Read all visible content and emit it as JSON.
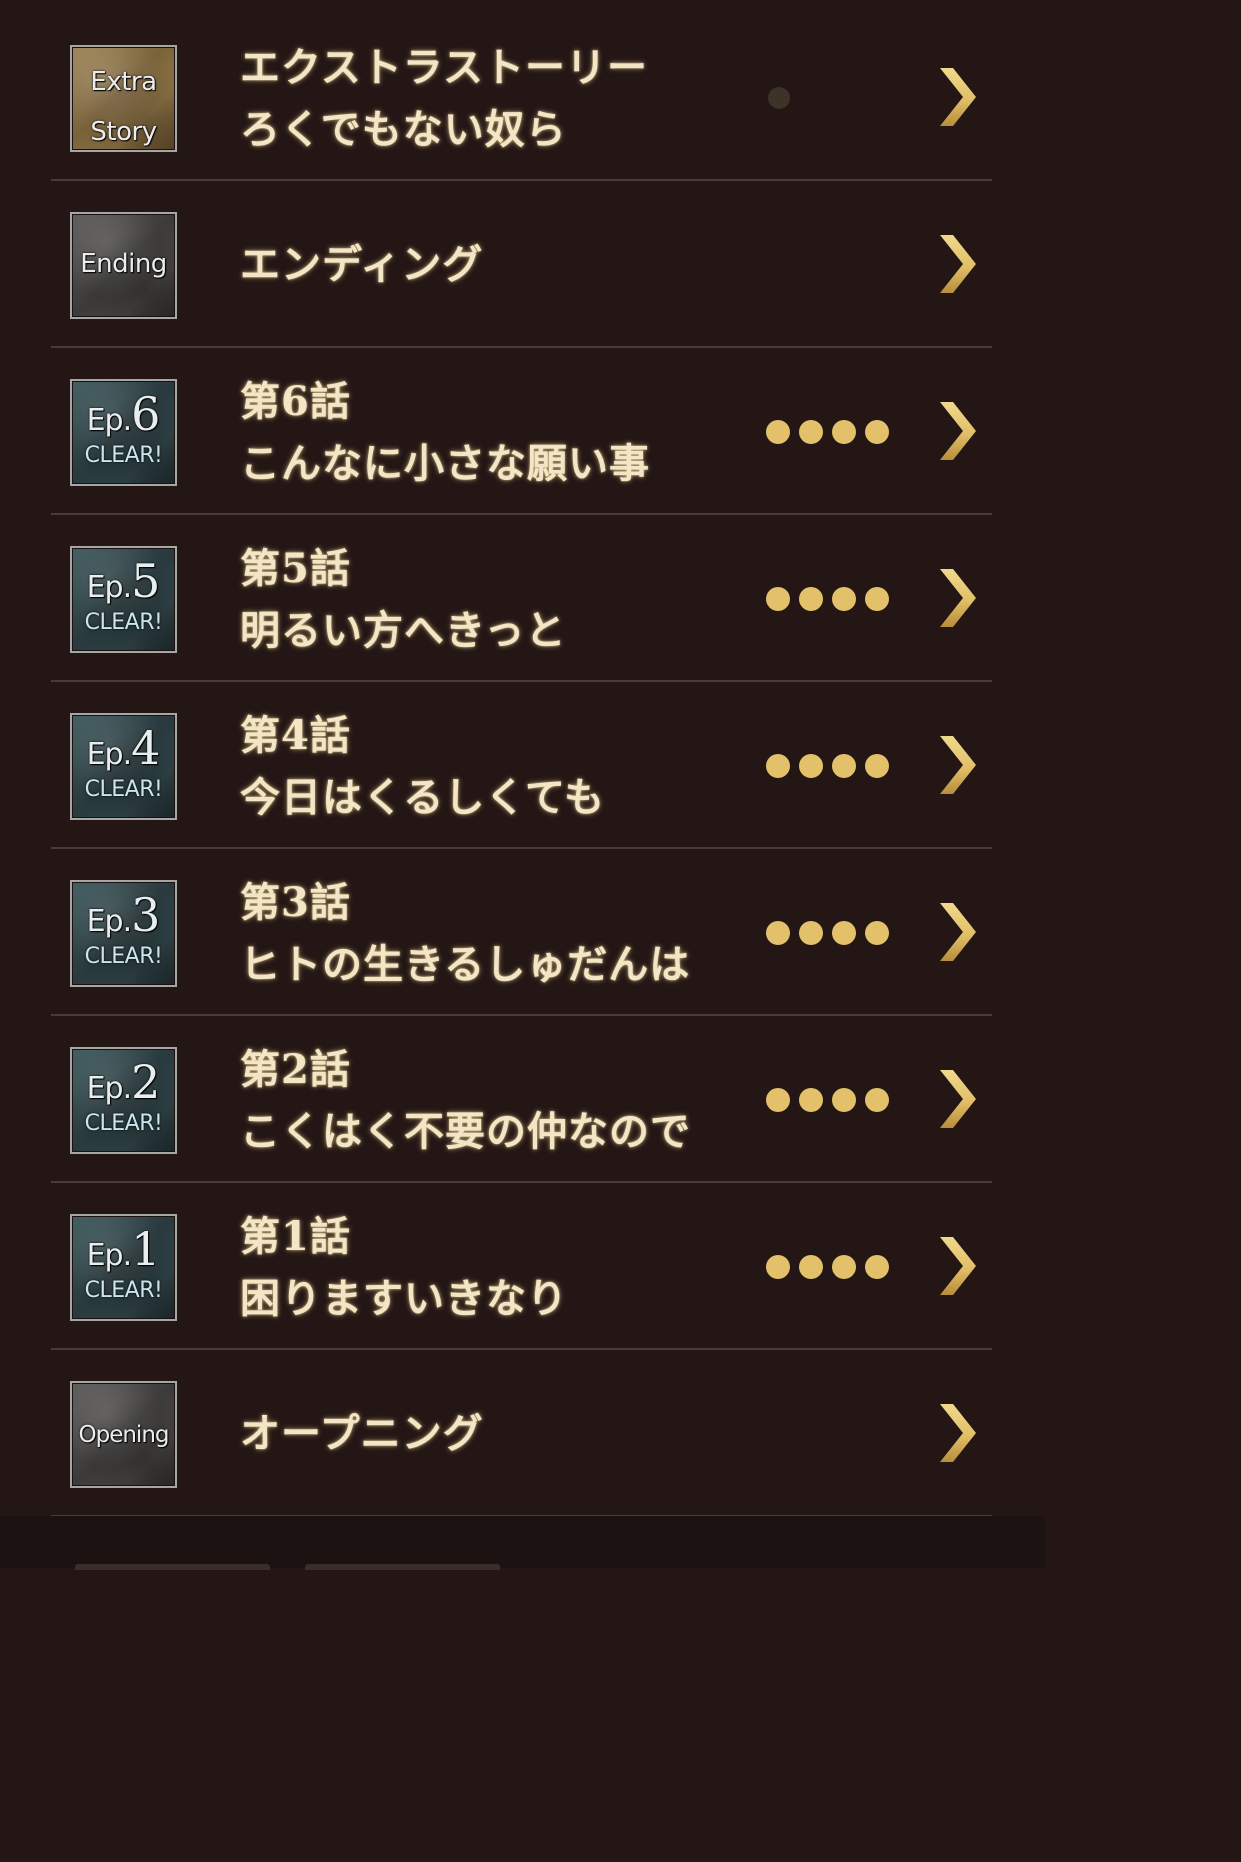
{
  "colors": {
    "background": "#231615",
    "title_text": "#f3e6c6",
    "dot_on": "#e3c16b",
    "dot_off": "#3d3327",
    "chevron": "#e2bf67",
    "divider": "#4b3b34"
  },
  "episodes": [
    {
      "badge": {
        "style": "gold",
        "line1": "Extra",
        "line2": "Story"
      },
      "title_line1": "エクストラストーリー",
      "title_line2": "ろくでもない奴ら",
      "dots": {
        "filled": 0,
        "total": 1
      }
    },
    {
      "badge": {
        "style": "grey",
        "line1": "Ending"
      },
      "title_line1": "エンディング",
      "dots": null
    },
    {
      "badge": {
        "style": "teal",
        "ep_prefix": "Ep.",
        "ep_number": "6",
        "status": "CLEAR!"
      },
      "title_line1": "第6話",
      "title_line2": "こんなに小さな願い事",
      "dots": {
        "filled": 4,
        "total": 4
      }
    },
    {
      "badge": {
        "style": "teal",
        "ep_prefix": "Ep.",
        "ep_number": "5",
        "status": "CLEAR!"
      },
      "title_line1": "第5話",
      "title_line2": "明るい方へきっと",
      "dots": {
        "filled": 4,
        "total": 4
      }
    },
    {
      "badge": {
        "style": "teal",
        "ep_prefix": "Ep.",
        "ep_number": "4",
        "status": "CLEAR!"
      },
      "title_line1": "第4話",
      "title_line2": "今日はくるしくても",
      "dots": {
        "filled": 4,
        "total": 4
      }
    },
    {
      "badge": {
        "style": "teal",
        "ep_prefix": "Ep.",
        "ep_number": "3",
        "status": "CLEAR!"
      },
      "title_line1": "第3話",
      "title_line2": "ヒトの生きるしゅだんは",
      "dots": {
        "filled": 4,
        "total": 4
      }
    },
    {
      "badge": {
        "style": "teal",
        "ep_prefix": "Ep.",
        "ep_number": "2",
        "status": "CLEAR!"
      },
      "title_line1": "第2話",
      "title_line2": "こくはく不要の仲なので",
      "dots": {
        "filled": 4,
        "total": 4
      }
    },
    {
      "badge": {
        "style": "teal",
        "ep_prefix": "Ep.",
        "ep_number": "1",
        "status": "CLEAR!"
      },
      "title_line1": "第1話",
      "title_line2": "困りますいきなり",
      "dots": {
        "filled": 4,
        "total": 4
      }
    },
    {
      "badge": {
        "style": "grey",
        "line1": "Opening"
      },
      "title_line1": "オープニング",
      "dots": null
    }
  ]
}
